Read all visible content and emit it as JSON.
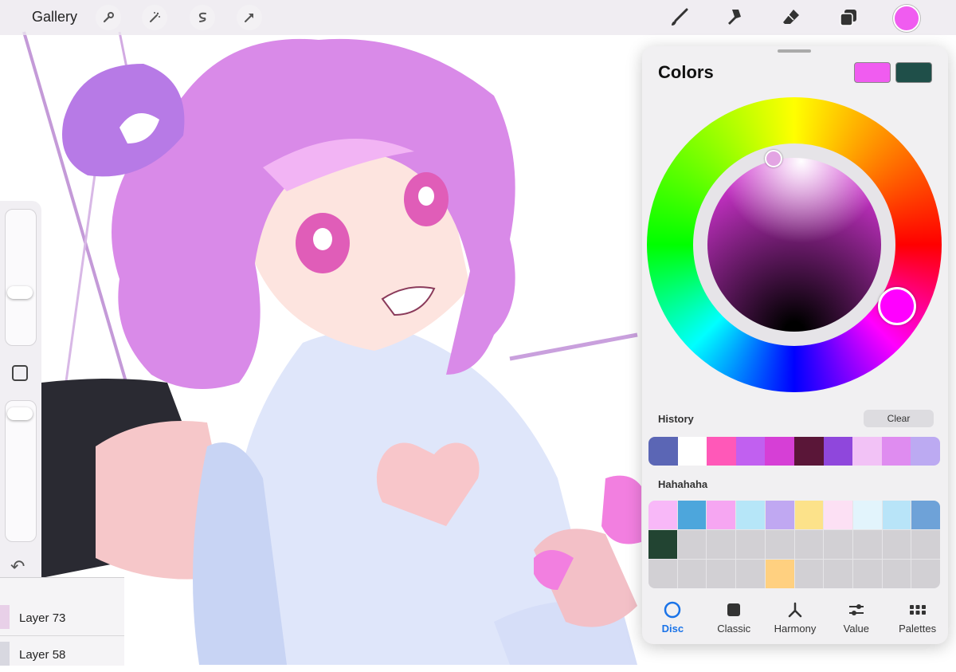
{
  "topbar": {
    "gallery_label": "Gallery"
  },
  "colors": {
    "current_primary": "#f05cf0",
    "current_secondary": "#1f4f49",
    "accent": "#1a73e8"
  },
  "panel": {
    "title": "Colors",
    "history_label": "History",
    "clear_label": "Clear",
    "palette_label": "Hahahaha",
    "history_swatches": [
      "#5b66b5",
      "#ffffff",
      "#ff58b8",
      "#c160f0",
      "#d63fd6",
      "#5a1638",
      "#8f47dc",
      "#f2c2f6",
      "#df8cf0",
      "#bcaaf2"
    ],
    "palette_swatches": [
      "#f8b8f8",
      "#4da6dc",
      "#f6a6f2",
      "#b6e6f8",
      "#c0a8f2",
      "#fce28a",
      "#fce0f4",
      "#e2f4fc",
      "#b8e4f8",
      "#6ea2d8",
      "#224432"
    ],
    "palette_extra_swatch": "#ffd080",
    "tabs": [
      {
        "label": "Disc",
        "active": true
      },
      {
        "label": "Classic",
        "active": false
      },
      {
        "label": "Harmony",
        "active": false
      },
      {
        "label": "Value",
        "active": false
      },
      {
        "label": "Palettes",
        "active": false
      }
    ]
  },
  "layers": [
    {
      "name": "Layer 73"
    },
    {
      "name": "Layer 58"
    }
  ]
}
